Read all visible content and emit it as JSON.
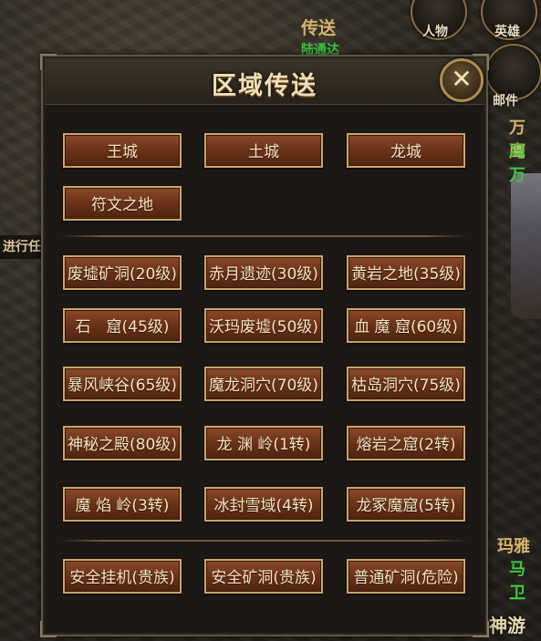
{
  "background": {
    "teleport_text": "传送",
    "green_text": "陆通达",
    "task_text": "进行任",
    "npc_name_1": "万鹰",
    "npc_name_2": "冯万",
    "npc_name_3": "玛雅",
    "npc_name_4": "马卫",
    "watermark": "嘻神游"
  },
  "hud": {
    "person_label": "人物",
    "hero_label": "英雄",
    "mail_label": "邮件"
  },
  "panel": {
    "title": "区域传送",
    "close_glyph": "✕",
    "cities": [
      "王城",
      "土城",
      "龙城",
      "符文之地"
    ],
    "dungeons": [
      "废墟矿洞(20级)",
      "赤月遗迹(30级)",
      "黄岩之地(35级)",
      "石　窟(45级)",
      "沃玛废墟(50级)",
      "血 魔 窟(60级)",
      "暴风峡谷(65级)",
      "魔龙洞穴(70级)",
      "枯岛洞穴(75级)",
      "神秘之殿(80级)",
      "龙 渊 岭(1转)",
      "熔岩之窟(2转)",
      "魔 焰 岭(3转)",
      "冰封雪域(4转)",
      "龙冢魔窟(5转)"
    ],
    "afk": [
      "安全挂机(贵族)",
      "安全矿洞(贵族)",
      "普通矿洞(危险)"
    ]
  }
}
